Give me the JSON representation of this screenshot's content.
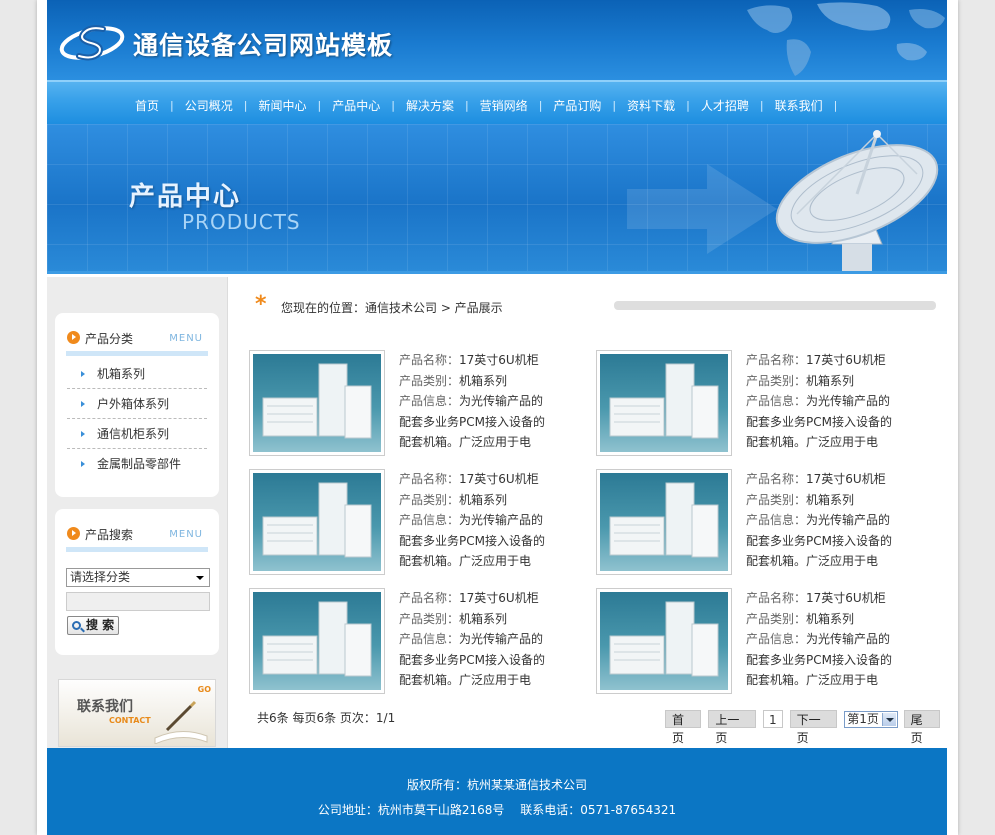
{
  "header": {
    "site_title": "通信设备公司网站模板"
  },
  "nav": {
    "items": [
      "首页",
      "公司概况",
      "新闻中心",
      "产品中心",
      "解决方案",
      "营销网络",
      "产品订购",
      "资料下载",
      "人才招聘",
      "联系我们"
    ]
  },
  "banner": {
    "title_cn": "产品中心",
    "title_en": "PRODUCTS"
  },
  "sidebar": {
    "category_box": {
      "title": "产品分类",
      "menu_label": "MENU",
      "items": [
        "机箱系列",
        "户外箱体系列",
        "通信机柜系列",
        "金属制品零部件"
      ]
    },
    "search_box": {
      "title": "产品搜索",
      "menu_label": "MENU",
      "select_value": "请选择分类",
      "keyword_value": "",
      "button_label": "搜 索"
    },
    "contact": {
      "title_cn": "联系我们",
      "title_en": "CONTACT",
      "go": "GO"
    }
  },
  "breadcrumb": {
    "text": "您现在的位置：通信技术公司 > 产品展示"
  },
  "products": [
    {
      "name_label": "产品名称：",
      "name": "17英寸6U机柜",
      "cat_label": "产品类别：",
      "category": "机箱系列",
      "info_label": "产品信息：",
      "info_line1": "为光传输产品的",
      "info_line2": "配套多业务PCM接入设备的",
      "info_line3": "配套机箱。广泛应用于电"
    },
    {
      "name_label": "产品名称：",
      "name": "17英寸6U机柜",
      "cat_label": "产品类别：",
      "category": "机箱系列",
      "info_label": "产品信息：",
      "info_line1": "为光传输产品的",
      "info_line2": "配套多业务PCM接入设备的",
      "info_line3": "配套机箱。广泛应用于电"
    },
    {
      "name_label": "产品名称：",
      "name": "17英寸6U机柜",
      "cat_label": "产品类别：",
      "category": "机箱系列",
      "info_label": "产品信息：",
      "info_line1": "为光传输产品的",
      "info_line2": "配套多业务PCM接入设备的",
      "info_line3": "配套机箱。广泛应用于电"
    },
    {
      "name_label": "产品名称：",
      "name": "17英寸6U机柜",
      "cat_label": "产品类别：",
      "category": "机箱系列",
      "info_label": "产品信息：",
      "info_line1": "为光传输产品的",
      "info_line2": "配套多业务PCM接入设备的",
      "info_line3": "配套机箱。广泛应用于电"
    },
    {
      "name_label": "产品名称：",
      "name": "17英寸6U机柜",
      "cat_label": "产品类别：",
      "category": "机箱系列",
      "info_label": "产品信息：",
      "info_line1": "为光传输产品的",
      "info_line2": "配套多业务PCM接入设备的",
      "info_line3": "配套机箱。广泛应用于电"
    },
    {
      "name_label": "产品名称：",
      "name": "17英寸6U机柜",
      "cat_label": "产品类别：",
      "category": "机箱系列",
      "info_label": "产品信息：",
      "info_line1": "为光传输产品的",
      "info_line2": "配套多业务PCM接入设备的",
      "info_line3": "配套机箱。广泛应用于电"
    }
  ],
  "pager": {
    "summary": "共6条 每页6条 页次：1/1",
    "first": "首页",
    "prev": "上一页",
    "current": "1",
    "next": "下一页",
    "page_select": "第1页",
    "last": "尾页"
  },
  "footer": {
    "line1": "版权所有：杭州某某通信技术公司",
    "line2": "公司地址：杭州市莫干山路2168号　 联系电话：0571-87654321"
  },
  "colors": {
    "header_blue": "#0b62b6",
    "nav_blue": "#3aa2ea",
    "footer_blue": "#0b76c4",
    "accent_orange": "#f08a1c"
  }
}
